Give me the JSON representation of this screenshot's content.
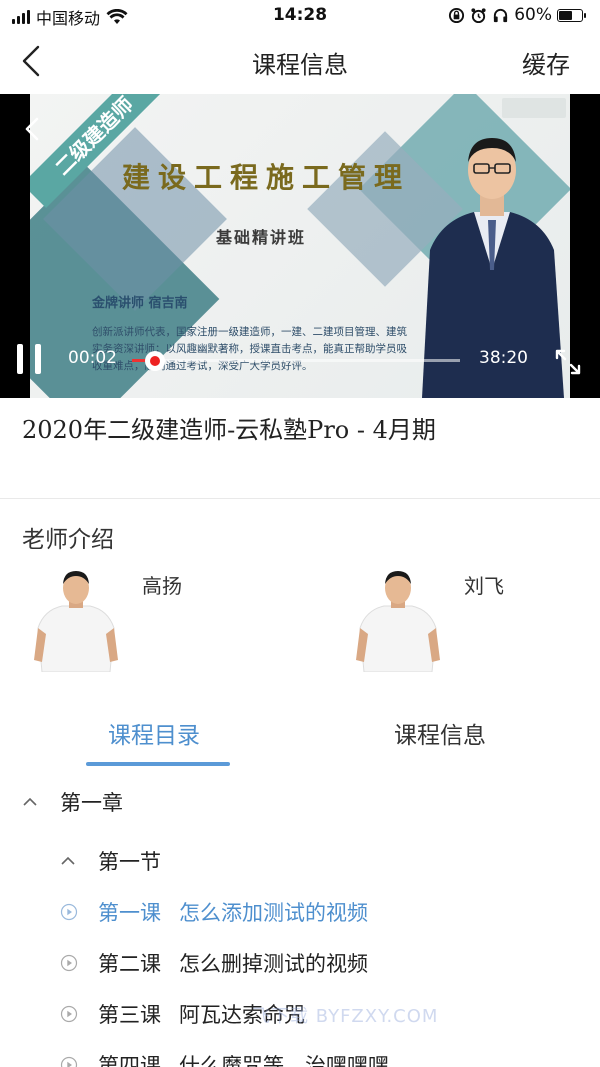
{
  "status_bar": {
    "carrier": "中国移动",
    "time": "14:28",
    "battery": "60%",
    "battery_level": 0.6
  },
  "nav": {
    "title": "课程信息",
    "cache_label": "缓存"
  },
  "video": {
    "slide_banner": "二级建造师",
    "slide_title": "建设工程施工管理",
    "slide_subtitle": "基础精讲班",
    "slide_teacher": "金牌讲师  宿吉南",
    "slide_desc": "创新派讲师代表，国家注册一级建造师，一建、二建项目管理、建筑实务资深讲师；以风趣幽默著称，授课直击考点，能真正帮助学员吸收重难点，顺利通过考试，深受广大学员好评。",
    "current_time": "00:02",
    "total_time": "38:20",
    "progress": 0.07
  },
  "course": {
    "title": "2020年二级建造师-云私塾Pro - 4月期"
  },
  "teachers": {
    "section_title": "老师介绍",
    "items": [
      {
        "name": "高扬"
      },
      {
        "name": "刘飞"
      }
    ]
  },
  "tabs": {
    "catalog": "课程目录",
    "info": "课程信息"
  },
  "outline": {
    "chapter": "第一章",
    "section": "第一节",
    "lessons": [
      {
        "num": "第一课",
        "title": "怎么添加测试的视频"
      },
      {
        "num": "第二课",
        "title": "怎么删掉测试的视频"
      },
      {
        "num": "第三课",
        "title": "阿瓦达索命咒"
      },
      {
        "num": "第四课",
        "title": "什么魔咒等，治嘿嘿嘿"
      }
    ]
  },
  "watermark": "飞下载 BYFZXY.COM"
}
